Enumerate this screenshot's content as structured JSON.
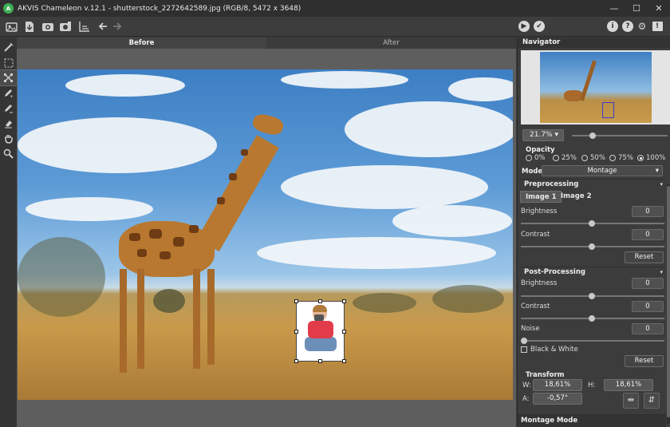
{
  "window": {
    "logo_letter": "A",
    "title": "AKVIS Chameleon v.12.1 - shutterstock_2272642589.jpg (RGB/8, 5472 x 3648)",
    "minimize": "—",
    "maximize": "☐",
    "close": "✕"
  },
  "toolbar": {
    "icons": [
      "open-file-icon",
      "save-file-icon",
      "batch-icon",
      "settings-icon",
      "print-icon",
      "undo-icon",
      "redo-icon",
      "run-icon",
      "apply-icon",
      "info-icon",
      "help-icon",
      "preferences-icon",
      "notifications-icon"
    ],
    "run_glyph": "▶",
    "apply_glyph": "✔",
    "info_glyph": "i",
    "help_glyph": "?",
    "prefs_glyph": "⚙",
    "notif_glyph": "!"
  },
  "tools": [
    "magic-brush-icon",
    "selection-icon",
    "transform-icon",
    "keep-pencil-icon",
    "drop-pencil-icon",
    "eraser-icon",
    "hand-icon",
    "zoom-icon"
  ],
  "canvas": {
    "tab_before": "Before",
    "tab_after": "After"
  },
  "navigator": {
    "title": "Navigator",
    "zoom": "21.7%",
    "zoom_arrow": "▾"
  },
  "opacity": {
    "title": "Opacity",
    "options": [
      "0%",
      "25%",
      "50%",
      "75%",
      "100%"
    ],
    "selected": "100%"
  },
  "mode": {
    "label": "Mode",
    "value": "Montage",
    "arrow": "▾"
  },
  "preprocessing": {
    "title": "Preprocessing",
    "tab1": "Image 1",
    "tab2": "Image 2",
    "brightness_label": "Brightness",
    "brightness_value": "0",
    "contrast_label": "Contrast",
    "contrast_value": "0",
    "reset": "Reset"
  },
  "postprocessing": {
    "title": "Post-Processing",
    "brightness_label": "Brightness",
    "brightness_value": "0",
    "contrast_label": "Contrast",
    "contrast_value": "0",
    "noise_label": "Noise",
    "noise_value": "0",
    "bw_label": "Black & White",
    "reset": "Reset"
  },
  "transform": {
    "title": "Transform",
    "w_label": "W:",
    "w_value": "18,61%",
    "h_label": "H:",
    "h_value": "18,61%",
    "a_label": "A:",
    "a_value": "-0,57°"
  },
  "montage_mode": {
    "title": "Montage Mode"
  },
  "colors": {
    "accent": "#3fae55",
    "panel_bg": "#3c3c3c"
  }
}
